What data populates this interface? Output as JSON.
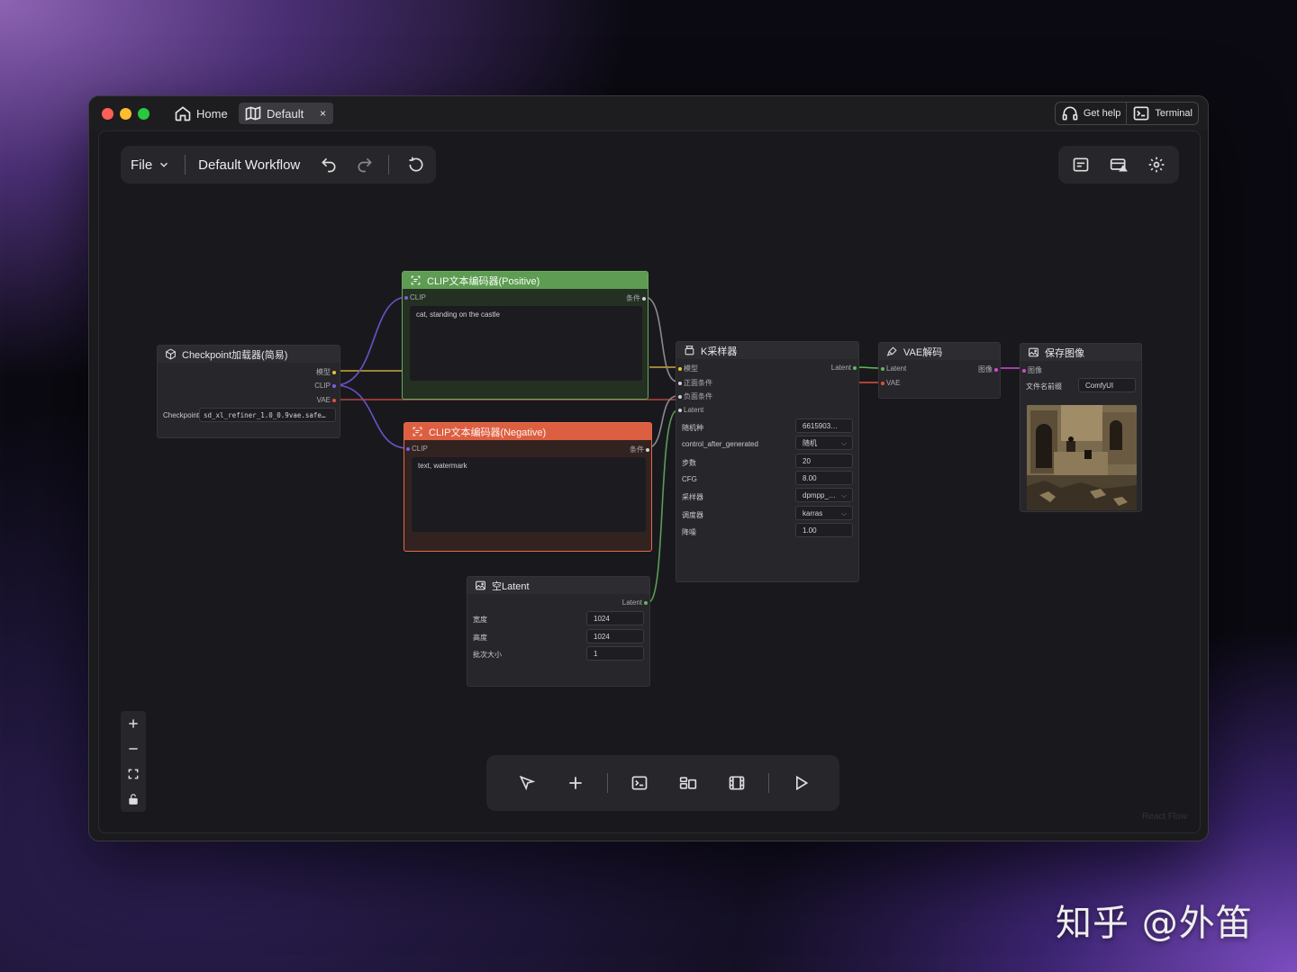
{
  "titlebar": {
    "tabs": [
      {
        "label": "Home",
        "icon": "home-icon"
      },
      {
        "label": "Default",
        "icon": "map-icon",
        "close": "×"
      }
    ],
    "get_help": "Get help",
    "terminal": "Terminal"
  },
  "menu": {
    "file": "File",
    "workflow_name": "Default Workflow"
  },
  "nodes": {
    "checkpoint": {
      "title": "Checkpoint加载器(简易)",
      "out_model": "模型",
      "out_clip": "CLIP",
      "out_vae": "VAE",
      "ckpt_label": "Checkpoint",
      "ckpt_value": "sd_xl_refiner_1.0_0.9vae.safe…"
    },
    "positive": {
      "title": "CLIP文本编码器(Positive)",
      "in_clip": "CLIP",
      "out_cond": "条件",
      "text": "cat, standing on the castle"
    },
    "negative": {
      "title": "CLIP文本编码器(Negative)",
      "in_clip": "CLIP",
      "out_cond": "条件",
      "text": "text, watermark"
    },
    "latent": {
      "title": "空Latent",
      "out": "Latent",
      "width_label": "宽度",
      "width_value": "1024",
      "height_label": "高度",
      "height_value": "1024",
      "batch_label": "批次大小",
      "batch_value": "1"
    },
    "ksampler": {
      "title": "K采样器",
      "in_model": "模型",
      "in_pos": "正面条件",
      "in_neg": "负面条件",
      "in_latent": "Latent",
      "out_latent": "Latent",
      "seed_label": "随机种",
      "seed_value": "6615903…",
      "control_label": "control_after_generated",
      "control_value": "随机",
      "steps_label": "步数",
      "steps_value": "20",
      "cfg_label": "CFG",
      "cfg_value": "8.00",
      "sampler_label": "采样器",
      "sampler_value": "dpmpp_…",
      "scheduler_label": "调度器",
      "scheduler_value": "karras",
      "denoise_label": "降噪",
      "denoise_value": "1.00"
    },
    "vae": {
      "title": "VAE解码",
      "in_latent": "Latent",
      "in_vae": "VAE",
      "out_image": "图像"
    },
    "save": {
      "title": "保存图像",
      "in_image": "图像",
      "prefix_label": "文件名前缀",
      "prefix_value": "ComfyUI"
    }
  },
  "footer": {
    "react_flow": "React Flow"
  },
  "watermark": "知乎 @外笛",
  "colors": {
    "positive": "#5e9b53",
    "negative": "#dd5f41",
    "model": "#e8c33a",
    "clip": "#7a5fe0",
    "vae": "#e0503f",
    "latent": "#5fba5a",
    "image": "#d04bd4"
  }
}
